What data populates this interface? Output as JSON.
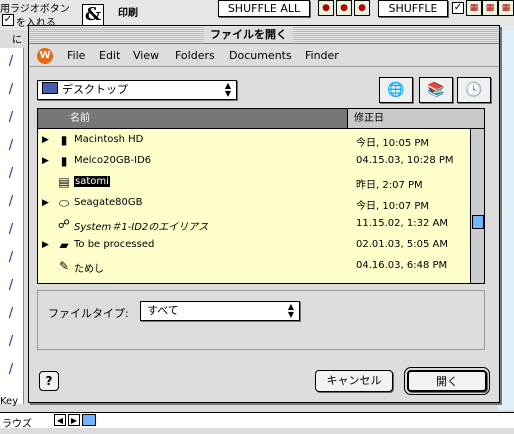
{
  "background": {
    "label_top_left_1": "用ラジオボタン",
    "label_top_left_2": "を入れる",
    "label_top_left_3": "に",
    "print_label": "印刷",
    "shuffle_all": "SHUFFLE ALL",
    "shuffle": "SHUFFLE",
    "key_label": "Key",
    "browse_label": "ラウズ",
    "pencil_glyph": "/"
  },
  "dialog": {
    "title": "ファイルを開く",
    "menu": [
      "File",
      "Edit",
      "View",
      "Folders",
      "Documents",
      "Finder"
    ],
    "location": "デスクトップ",
    "columns": {
      "name": "名前",
      "date": "修正日"
    },
    "files": [
      {
        "name": "Macintosh HD",
        "date": "今日, 10:05 PM",
        "icon": "hard-disk-icon",
        "glyph": "▮",
        "expandable": true,
        "selected": false,
        "alias": false
      },
      {
        "name": "Melco20GB-ID6",
        "date": "04.15.03, 10:28 PM",
        "icon": "drive-icon",
        "glyph": "▮",
        "expandable": true,
        "selected": false,
        "alias": false
      },
      {
        "name": "satomi",
        "date": "昨日, 2:07 PM",
        "icon": "document-icon",
        "glyph": "▤",
        "expandable": false,
        "selected": true,
        "alias": false
      },
      {
        "name": "Seagate80GB",
        "date": "今日, 10:07 PM",
        "icon": "drive-icon",
        "glyph": "⬭",
        "expandable": true,
        "selected": false,
        "alias": false
      },
      {
        "name": "System＃1-ID2のエイリアス",
        "date": "11.15.02, 1:32 AM",
        "icon": "network-alias-icon",
        "glyph": "☍",
        "expandable": false,
        "selected": false,
        "alias": true
      },
      {
        "name": "To be processed",
        "date": "02.01.03, 5:05 AM",
        "icon": "folder-icon",
        "glyph": "▰",
        "expandable": true,
        "selected": false,
        "alias": false
      },
      {
        "name": "ためし",
        "date": "04.16.03, 6:48 PM",
        "icon": "application-icon",
        "glyph": "✎",
        "expandable": false,
        "selected": false,
        "alias": false
      }
    ],
    "file_type_label": "ファイルタイプ:",
    "file_type_value": "すべて",
    "cancel": "キャンセル",
    "open": "開く",
    "help": "?",
    "app_icon": "W"
  },
  "colors": {
    "list_bg": "#ffffcc",
    "selection": "#000000",
    "scroll_thumb": "#6fb6ff"
  }
}
